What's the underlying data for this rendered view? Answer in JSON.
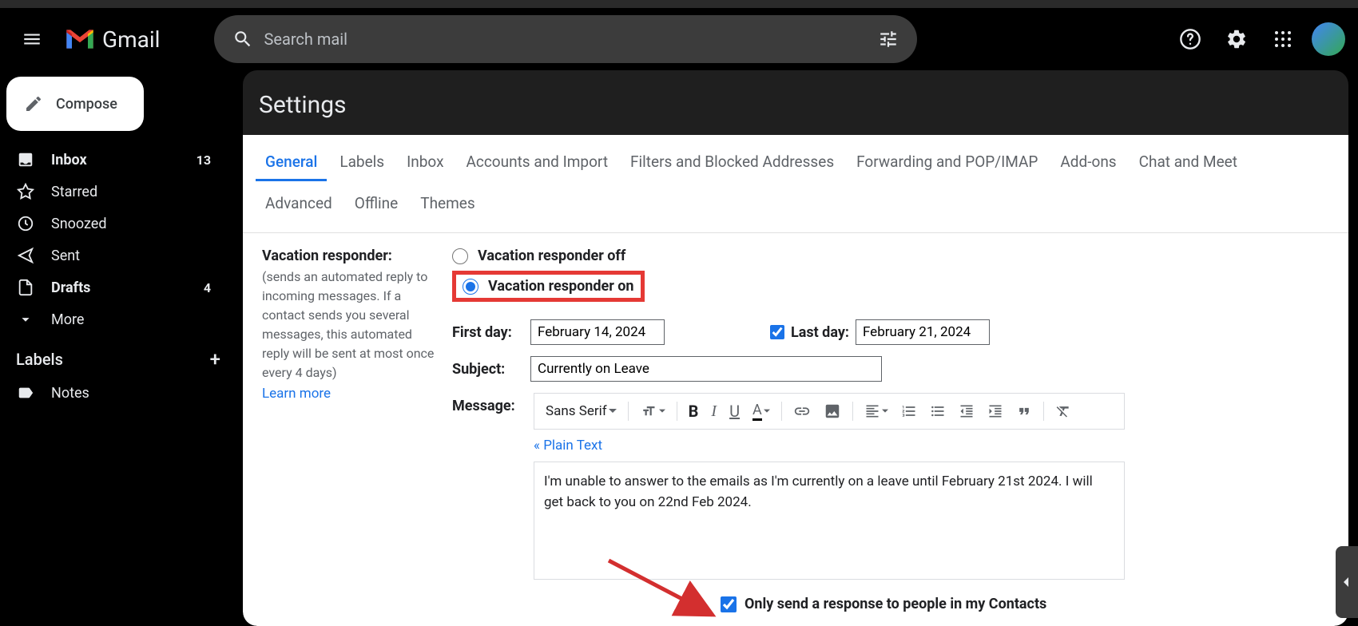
{
  "header": {
    "product_name": "Gmail",
    "search_placeholder": "Search mail"
  },
  "sidebar": {
    "compose_label": "Compose",
    "items": [
      {
        "label": "Inbox",
        "count": "13",
        "active": true
      },
      {
        "label": "Starred",
        "count": "",
        "active": false
      },
      {
        "label": "Snoozed",
        "count": "",
        "active": false
      },
      {
        "label": "Sent",
        "count": "",
        "active": false
      },
      {
        "label": "Drafts",
        "count": "4",
        "active": false
      },
      {
        "label": "More",
        "count": "",
        "active": false
      }
    ],
    "labels_header": "Labels",
    "user_labels": [
      {
        "label": "Notes"
      }
    ]
  },
  "settings": {
    "title": "Settings",
    "tabs": [
      "General",
      "Labels",
      "Inbox",
      "Accounts and Import",
      "Filters and Blocked Addresses",
      "Forwarding and POP/IMAP",
      "Add-ons",
      "Chat and Meet"
    ],
    "tabs_row2": [
      "Advanced",
      "Offline",
      "Themes"
    ],
    "active_tab": "General",
    "vacation": {
      "section_title": "Vacation responder:",
      "section_help": "(sends an automated reply to incoming messages. If a contact sends you several messages, this automated reply will be sent at most once every 4 days)",
      "learn_more": "Learn more",
      "radio_off": "Vacation responder off",
      "radio_on": "Vacation responder on",
      "radio_state": "on",
      "first_day_label": "First day:",
      "first_day_value": "February 14, 2024",
      "last_day_enabled": true,
      "last_day_label": "Last day:",
      "last_day_value": "February 21, 2024",
      "subject_label": "Subject:",
      "subject_value": "Currently on Leave",
      "message_label": "Message:",
      "font_name": "Sans Serif",
      "plain_text_link": "« Plain Text",
      "message_body": "I'm unable to answer to the emails as I'm currently on a leave until February 21st 2024. I will get back to you on 22nd Feb 2024.",
      "contacts_only_checked": true,
      "contacts_only_label": "Only send a response to people in my Contacts"
    }
  }
}
